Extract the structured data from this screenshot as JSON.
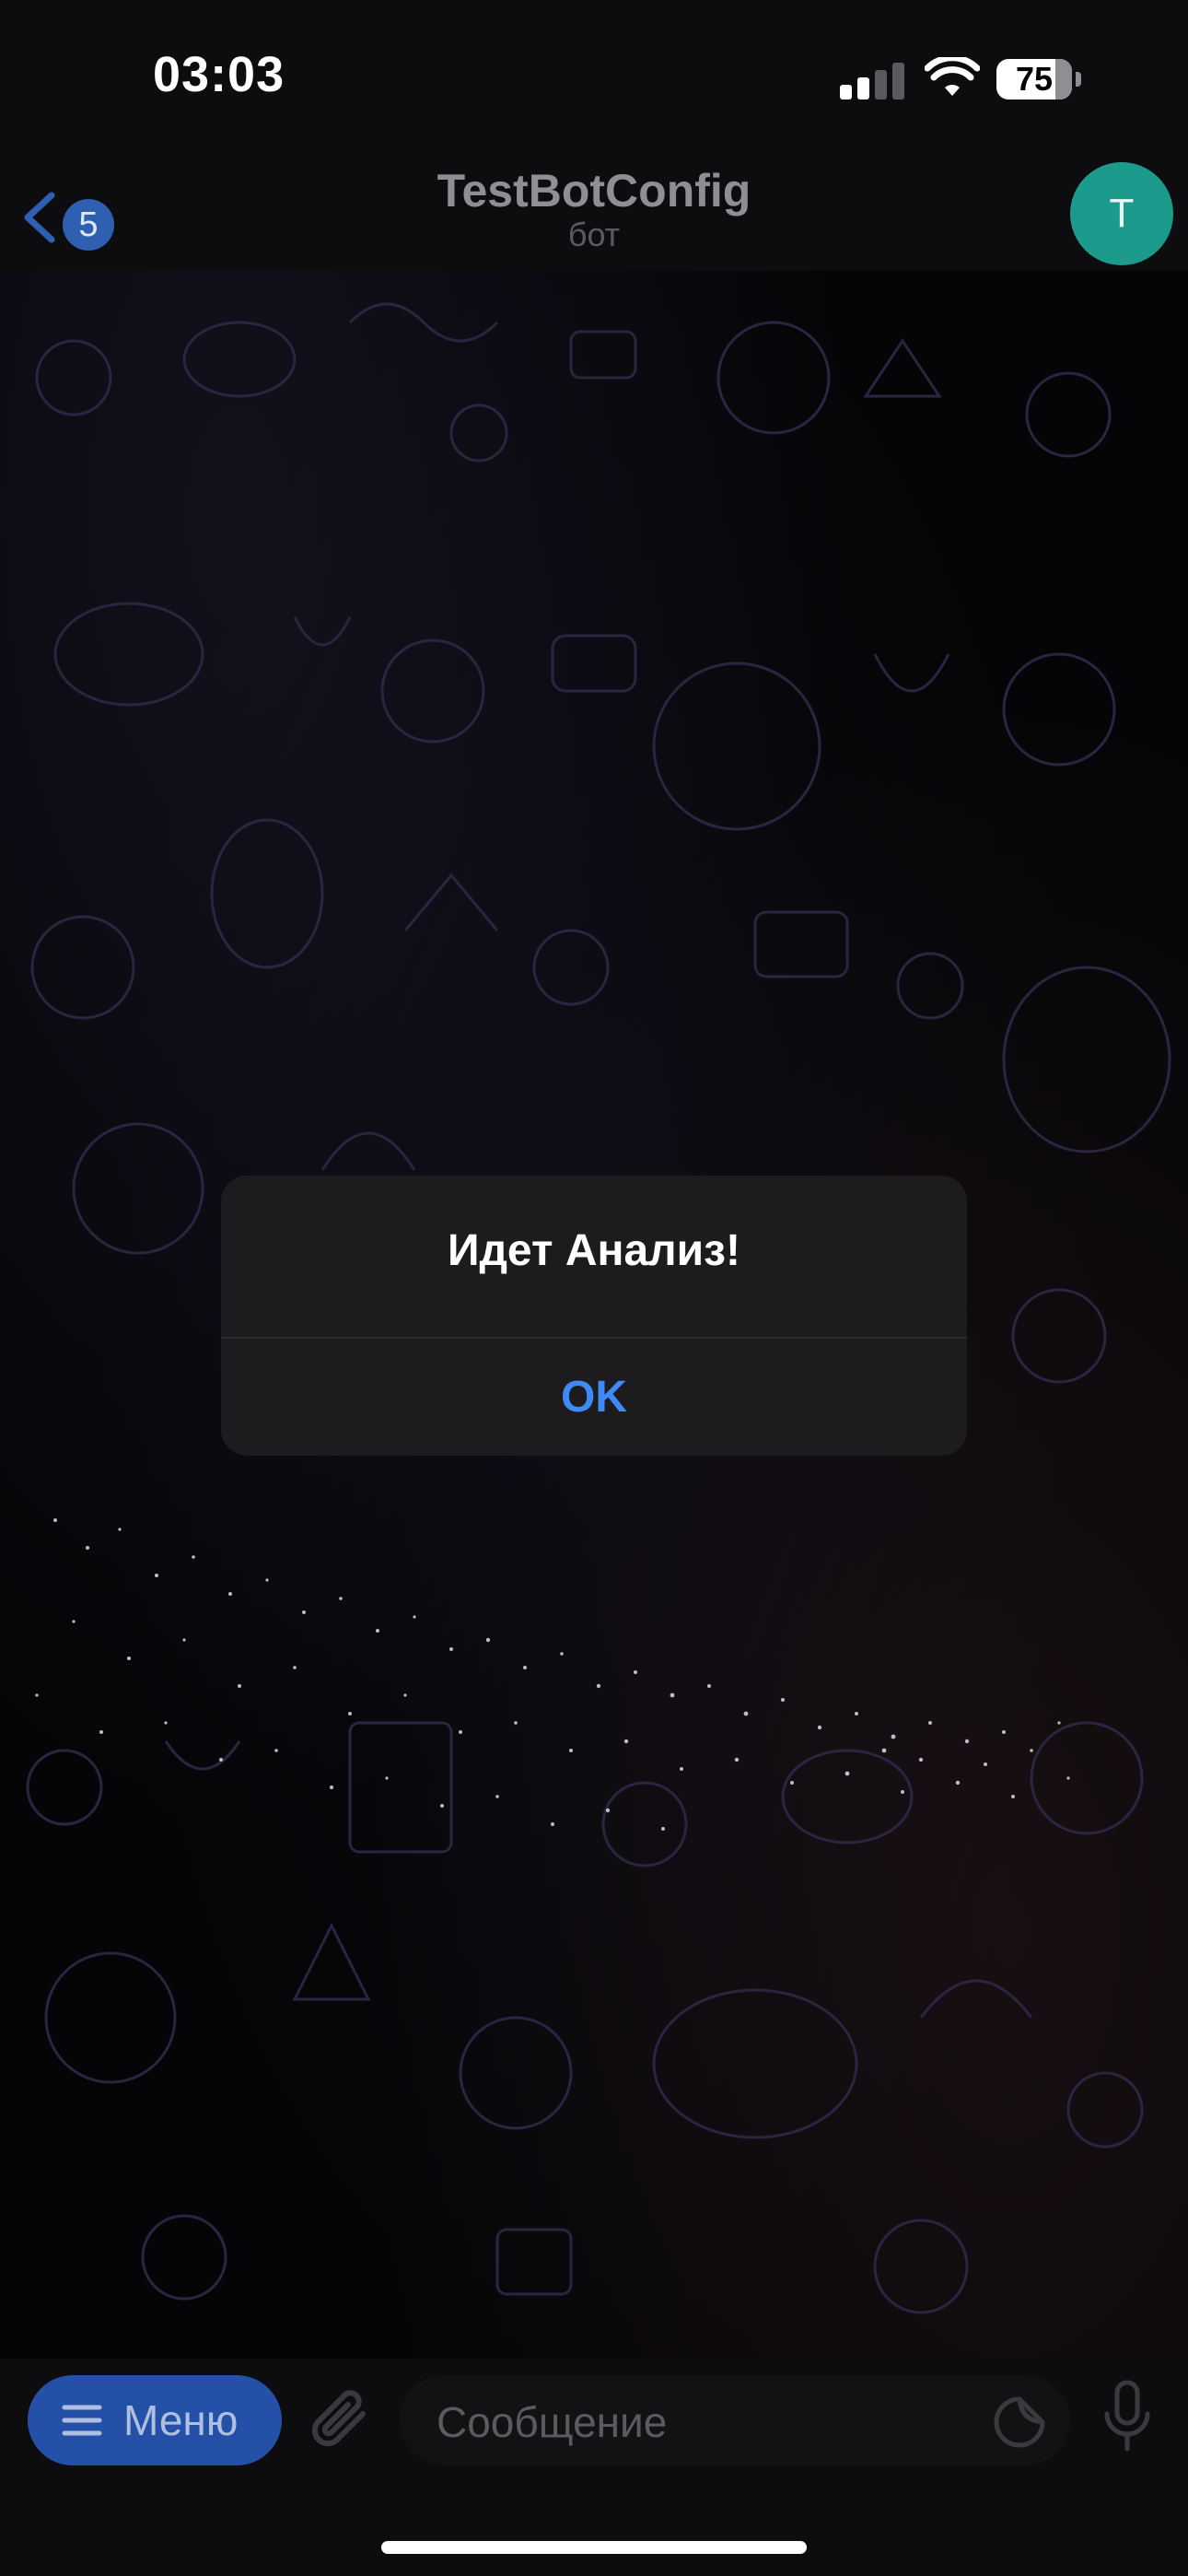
{
  "status_bar": {
    "time": "03:03",
    "battery": "75",
    "icons": [
      "cellular-signal-icon",
      "wifi-icon",
      "battery-icon"
    ]
  },
  "nav": {
    "unread_count": "5",
    "title": "TestBotConfig",
    "subtitle": "бот",
    "avatar_letter": "T",
    "avatar_color": "#1c9a8c"
  },
  "alert": {
    "title": "Идет Анализ!",
    "ok_label": "OK",
    "accent_color": "#3e8af7"
  },
  "input_bar": {
    "menu_label": "Меню",
    "placeholder": "Сообщение",
    "icons": [
      "hamburger-icon",
      "paperclip-icon",
      "sticker-icon",
      "microphone-icon"
    ]
  }
}
